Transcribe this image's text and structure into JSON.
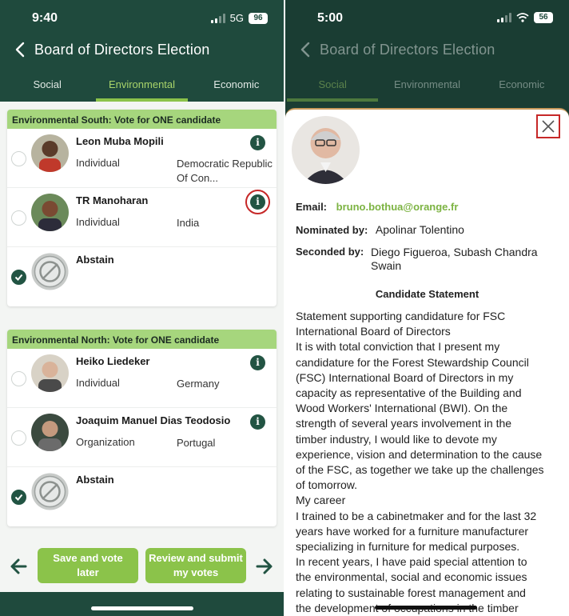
{
  "left": {
    "status": {
      "time": "9:40",
      "network": "5G",
      "battery": "96"
    },
    "title": "Board of Directors Election",
    "tabs": [
      "Social",
      "Environmental",
      "Economic"
    ],
    "active_tab": "Environmental",
    "sections": [
      {
        "header": "Environmental South: Vote for ONE candidate",
        "candidates": [
          {
            "name": "Leon Muba Mopili",
            "type": "Individual",
            "country": "Democratic Republic Of Con...",
            "selected": false
          },
          {
            "name": "TR Manoharan",
            "type": "Individual",
            "country": "India",
            "selected": false
          },
          {
            "name": "Abstain",
            "selected": true
          }
        ]
      },
      {
        "header": "Environmental North: Vote for ONE candidate",
        "candidates": [
          {
            "name": "Heiko Liedeker",
            "type": "Individual",
            "country": "Germany",
            "selected": false
          },
          {
            "name": "Joaquim Manuel Dias Teodosio",
            "type": "Organization",
            "country": "Portugal",
            "selected": false
          },
          {
            "name": "Abstain",
            "selected": true
          }
        ]
      }
    ],
    "buttons": {
      "save": "Save and vote later",
      "review": "Review and submit my votes"
    },
    "colors": {
      "header": "#1f4a3d",
      "accent": "#8bc34a",
      "section_header": "#a6d67d",
      "highlight": "#c62828"
    }
  },
  "right": {
    "status": {
      "time": "5:00",
      "battery": "56"
    },
    "title": "Board of Directors Election",
    "tabs": [
      "Social",
      "Environmental",
      "Economic"
    ],
    "modal": {
      "email_label": "Email:",
      "email": "bruno.bothua@orange.fr",
      "nominated_label": "Nominated by:",
      "nominated": "Apolinar Tolentino",
      "seconded_label": "Seconded by:",
      "seconded": "Diego Figueroa, Subash Chandra Swain",
      "statement_title": "Candidate Statement",
      "statement_lines": [
        "Statement supporting candidature for FSC",
        "International Board of Directors",
        "It is with total conviction that I present my",
        "candidature for the Forest Stewardship Council",
        "(FSC) International Board of Directors in my",
        "capacity as representative of the Building and",
        "Wood Workers' International (BWI). On the",
        "strength of several years involvement in the",
        "timber industry, I would like to devote my",
        "experience, vision and determination to the cause",
        "of the FSC, as together we take up the challenges",
        "of tomorrow.",
        "My career",
        "I trained to be a cabinetmaker and for the last 32",
        "years have worked for a furniture manufacturer",
        "specializing in furniture for medical purposes.",
        "In recent years, I have paid special attention to",
        "the environmental, social and economic issues",
        "relating to sustainable forest management and",
        "the development of occupations in the timber"
      ]
    }
  }
}
